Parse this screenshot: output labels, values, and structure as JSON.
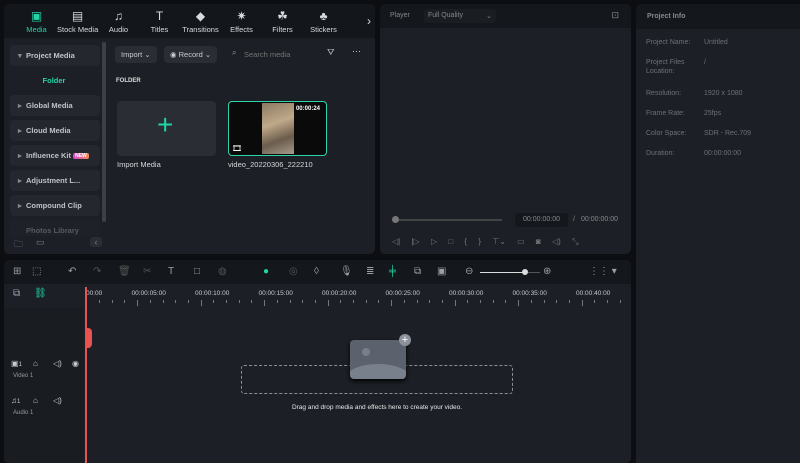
{
  "media_panel": {
    "tabs": [
      {
        "label": "Media",
        "icon": "media-icon",
        "active": true
      },
      {
        "label": "Stock Media",
        "icon": "stock-media-icon"
      },
      {
        "label": "Audio",
        "icon": "music-note-icon"
      },
      {
        "label": "Titles",
        "icon": "text-t-icon"
      },
      {
        "label": "Transitions",
        "icon": "transition-icon"
      },
      {
        "label": "Effects",
        "icon": "sparkle-icon"
      },
      {
        "label": "Filters",
        "icon": "filters-icon"
      },
      {
        "label": "Stickers",
        "icon": "sticker-icon"
      }
    ],
    "more": "›",
    "sidebar": {
      "project_media": "Project Media",
      "folder": "Folder",
      "items": [
        "Global Media",
        "Cloud Media",
        "Influence Kit",
        "Adjustment L...",
        "Compound Clip",
        "Photos Library"
      ],
      "new_badge": "NEW"
    },
    "toolbar": {
      "import": "Import",
      "record": "Record",
      "search_placeholder": "Search media",
      "more": "···"
    },
    "section": "FOLDER",
    "import_media": "Import Media",
    "clip": {
      "name": "video_20220306_222210",
      "duration": "00:00:24"
    }
  },
  "player": {
    "label": "Player",
    "quality": "Full Quality",
    "current": "00:00:00:00",
    "sep": "/",
    "total": "00:00:00:00"
  },
  "project_info": {
    "title": "Project Info",
    "rows": [
      {
        "k": "Project Name:",
        "v": "Untitled"
      },
      {
        "k": "Project Files Location:",
        "v": "/"
      },
      {
        "k": "Resolution:",
        "v": "1920 x 1080"
      },
      {
        "k": "Frame Rate:",
        "v": "25fps"
      },
      {
        "k": "Color Space:",
        "v": "SDR - Rec.709"
      },
      {
        "k": "Duration:",
        "v": "00:00:00:00"
      }
    ]
  },
  "timeline": {
    "ruler": [
      "00:00",
      "00:00:05:00",
      "00:00:10:00",
      "00:00:15:00",
      "00:00:20:00",
      "00:00:25:00",
      "00:00:30:00",
      "00:00:35:00",
      "00:00:40:00"
    ],
    "tracks": [
      {
        "num": "1",
        "name": "Video 1"
      },
      {
        "num": "1",
        "name": "Audio 1"
      }
    ],
    "zoom_level": 0.75,
    "drop_hint": "Drag and drop media and effects here to create your video."
  },
  "colors": {
    "accent": "#22d3a6",
    "playhead": "#e8534f"
  }
}
